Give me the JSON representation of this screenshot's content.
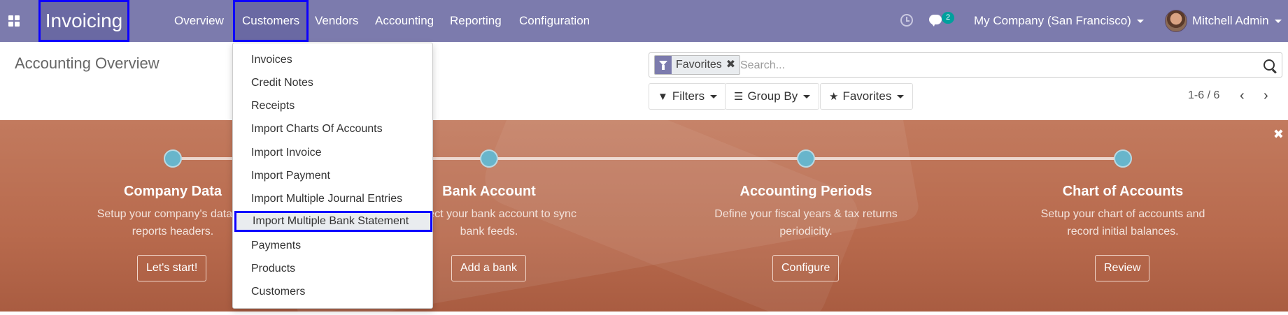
{
  "navbar": {
    "brand": "Invoicing",
    "menu": [
      "Overview",
      "Customers",
      "Vendors",
      "Accounting",
      "Reporting",
      "Configuration"
    ],
    "messages_count": "2",
    "company": "My Company (San Francisco)",
    "user": "Mitchell Admin"
  },
  "control_panel": {
    "title": "Accounting Overview",
    "facet_label": "Favorites",
    "search_placeholder": "Search...",
    "filters_label": "Filters",
    "groupby_label": "Group By",
    "favorites_label": "Favorites",
    "pager": "1-6 / 6"
  },
  "customers_menu": {
    "items": [
      "Invoices",
      "Credit Notes",
      "Receipts",
      "Import Charts Of Accounts",
      "Import Invoice",
      "Import Payment",
      "Import Multiple Journal Entries",
      "Import Multiple Bank Statement",
      "Payments",
      "Products",
      "Customers"
    ],
    "highlighted": "Import Multiple Bank Statement"
  },
  "onboarding": {
    "steps": [
      {
        "title": "Company Data",
        "desc_line1": "Setup your company's data for",
        "desc_line2": "reports headers.",
        "button": "Let's start!"
      },
      {
        "title": "Bank Account",
        "desc_line1": "Connect your bank account to sync",
        "desc_line2": "bank feeds.",
        "button": "Add a bank"
      },
      {
        "title": "Accounting Periods",
        "desc_line1": "Define your fiscal years & tax returns",
        "desc_line2": "periodicity.",
        "button": "Configure"
      },
      {
        "title": "Chart of Accounts",
        "desc_line1": "Setup your chart of accounts and",
        "desc_line2": "record initial balances.",
        "button": "Review"
      }
    ]
  },
  "colors": {
    "navbar": "#7c7bad",
    "highlight_border": "#0d00ff",
    "banner": "#b86a4d",
    "step_dot": "#68b5cb"
  }
}
